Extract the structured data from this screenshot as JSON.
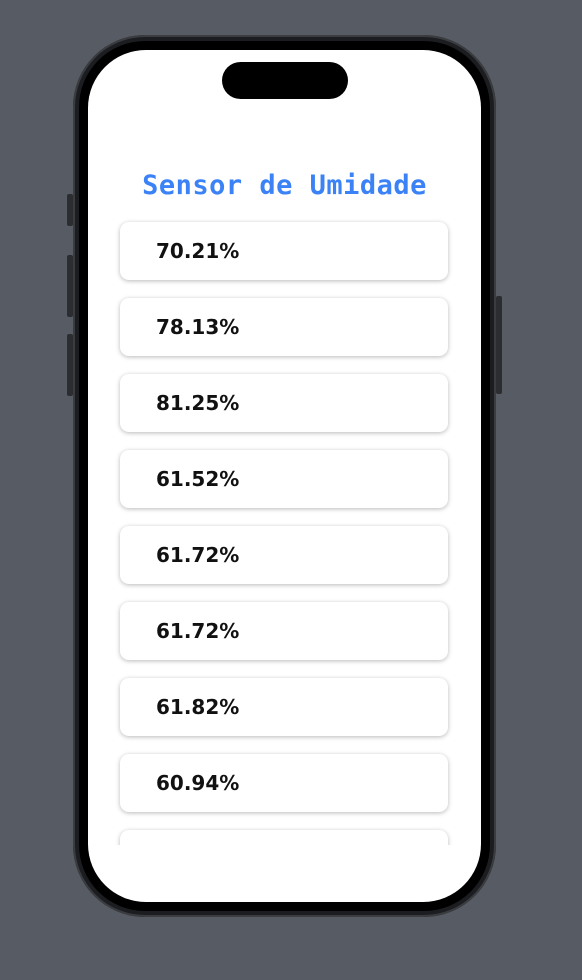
{
  "app": {
    "title": "Sensor de Umidade"
  },
  "readings": [
    {
      "value": "70.21%"
    },
    {
      "value": "78.13%"
    },
    {
      "value": "81.25%"
    },
    {
      "value": "61.52%"
    },
    {
      "value": "61.72%"
    },
    {
      "value": "61.72%"
    },
    {
      "value": "61.82%"
    },
    {
      "value": "60.94%"
    },
    {
      "value": ""
    }
  ],
  "colors": {
    "title": "#3b82f6",
    "background": "#575c64",
    "card": "#ffffff",
    "text": "#111111"
  }
}
